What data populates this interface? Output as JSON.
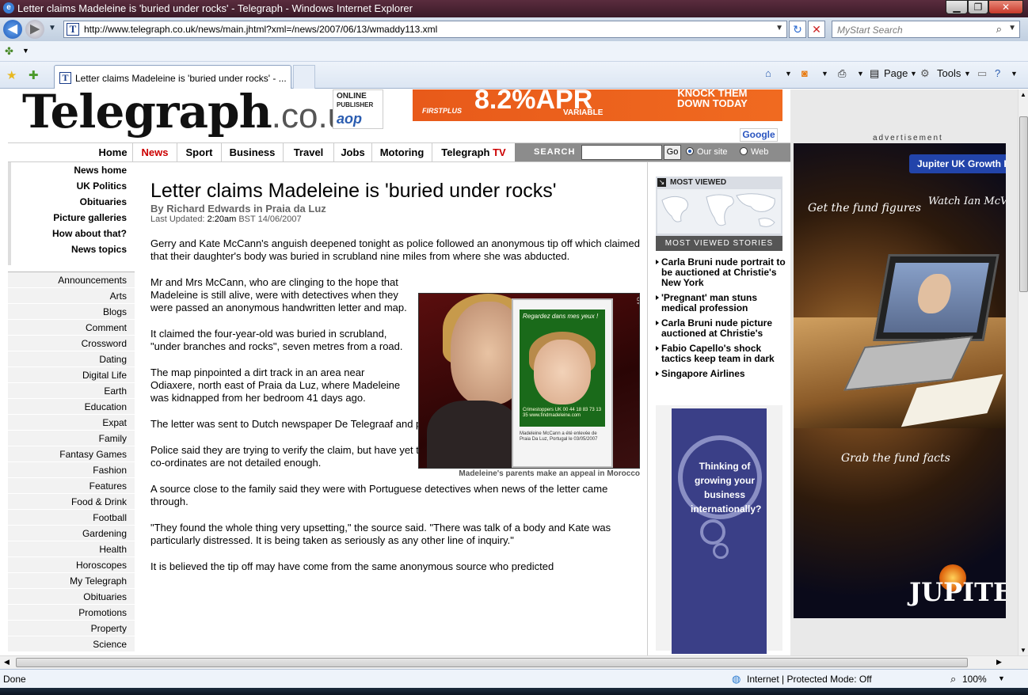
{
  "window": {
    "title": "Letter claims Madeleine is 'buried under rocks' - Telegraph - Windows Internet Explorer",
    "min": "▁",
    "max": "❐",
    "close": "✕"
  },
  "address_bar": {
    "url": "http://www.telegraph.co.uk/news/main.jhtml?xml=/news/2007/06/13/wmaddy113.xml",
    "search_placeholder": "MyStart Search",
    "back": "◀",
    "forward": "▶",
    "refresh": "↻",
    "stop": "✕"
  },
  "tab": {
    "label": "Letter claims Madeleine is 'buried under rocks' - ...",
    "favicon": "T"
  },
  "command_bar": {
    "page": "Page",
    "tools": "Tools"
  },
  "masthead": {
    "logo": "Telegraph",
    "logo_domain": ".co.uk",
    "publisher_line1": "ONLINE",
    "publisher_line2": "PUBLISHER",
    "publisher_logo": "aop",
    "banner_rate": "8.2%APR",
    "banner_variable": "VARIABLE",
    "banner_brand": "FIRSTPLUS",
    "banner_tagline_1": "KNOCK THEM",
    "banner_tagline_2": "DOWN TODAY",
    "google": "Google"
  },
  "topnav": {
    "items": [
      "Home",
      "News",
      "Sport",
      "Business",
      "Travel",
      "Jobs",
      "Motoring"
    ],
    "tv_label_1": "Telegraph",
    "tv_label_2": " TV",
    "search_label": "SEARCH",
    "go": "Go",
    "radio_site": "Our site",
    "radio_web": "Web"
  },
  "leftnav_primary": [
    "News home",
    "UK Politics",
    "Obituaries",
    "Picture galleries",
    "How about that?",
    "News topics"
  ],
  "leftnav_secondary": [
    "Announcements",
    "Arts",
    "Blogs",
    "Comment",
    "Crossword",
    "Dating",
    "Digital Life",
    "Earth",
    "Education",
    "Expat",
    "Family",
    "Fantasy Games",
    "Fashion",
    "Features",
    "Food & Drink",
    "Football",
    "Gardening",
    "Health",
    "Horoscopes",
    "My Telegraph",
    "Obituaries",
    "Promotions",
    "Property",
    "Science"
  ],
  "article": {
    "headline": "Letter claims Madeleine is 'buried under rocks'",
    "byline": "By Richard Edwards in Praia da Luz",
    "updated_label": "Last Updated: ",
    "updated_time": "2:20am",
    "updated_rest": " BST 14/06/2007",
    "paragraphs": [
      "Gerry and Kate McCann's anguish deepened tonight as police followed an anonymous tip off which claimed that their daughter's body was buried in scrubland nine miles from where she was abducted.",
      "Mr and Mrs McCann, who are clinging to the hope that Madeleine is still alive, were with detectives when they were passed an anonymous handwritten letter and map.",
      "It claimed the four-year-old was buried in scrubland, \"under branches and rocks\", seven metres from a road.",
      "The map pinpointed a dirt track in an area near Odiaxere, north east of Praia da Luz, where Madeleine was kidnapped from her bedroom 41 days ago.",
      "The letter was sent to Dutch newspaper De Telegraaf and passed on to the Portuguese police today.",
      "Police said they are trying to verify the claim, but have yet to start searching the area, amid concerns the co-ordinates are not detailed enough.",
      "A source close to the family said they were with Portuguese detectives when news of the letter came through.",
      "\"They found the whole thing very upsetting,\" the source said. \"There was talk of a body and Kate was particularly distressed. It is being taken as seriously as any other line of inquiry.\"",
      "It is believed the tip off may have come from the same anonymous source who predicted"
    ],
    "photo_credit": "AP",
    "poster_title": "Regardez dans mes yeux !",
    "poster_text": "Madeleine McCann a été enlevée de Praia Da Luz, Portugal le 03/05/2007",
    "poster_contact": "Crimestoppers UK 00 44 18 83 73 13 35 www.findmadeleine.com",
    "caption": "Madeleine's parents make an appeal in Morocco"
  },
  "most_viewed": {
    "title": "MOST VIEWED",
    "bar": "MOST VIEWED STORIES",
    "items": [
      "Carla Bruni nude portrait to be auctioned at Christie's New York",
      "'Pregnant' man stuns medical profession",
      "Carla Bruni nude picture auctioned at Christie's",
      "Fabio Capello's shock tactics keep team in dark",
      "Singapore Airlines"
    ],
    "ad_text": "Thinking of growing your business internationally?"
  },
  "advert": {
    "label": "advertisement",
    "tag": "Jupiter UK Growth F",
    "line1": "Get the fund figures",
    "line2": "Watch Ian McVeig",
    "line3": "Grab the fund facts",
    "logo": "JUPITE"
  },
  "status": {
    "text": "Done",
    "zone": "Internet | Protected Mode: Off",
    "zoom": "100%"
  }
}
